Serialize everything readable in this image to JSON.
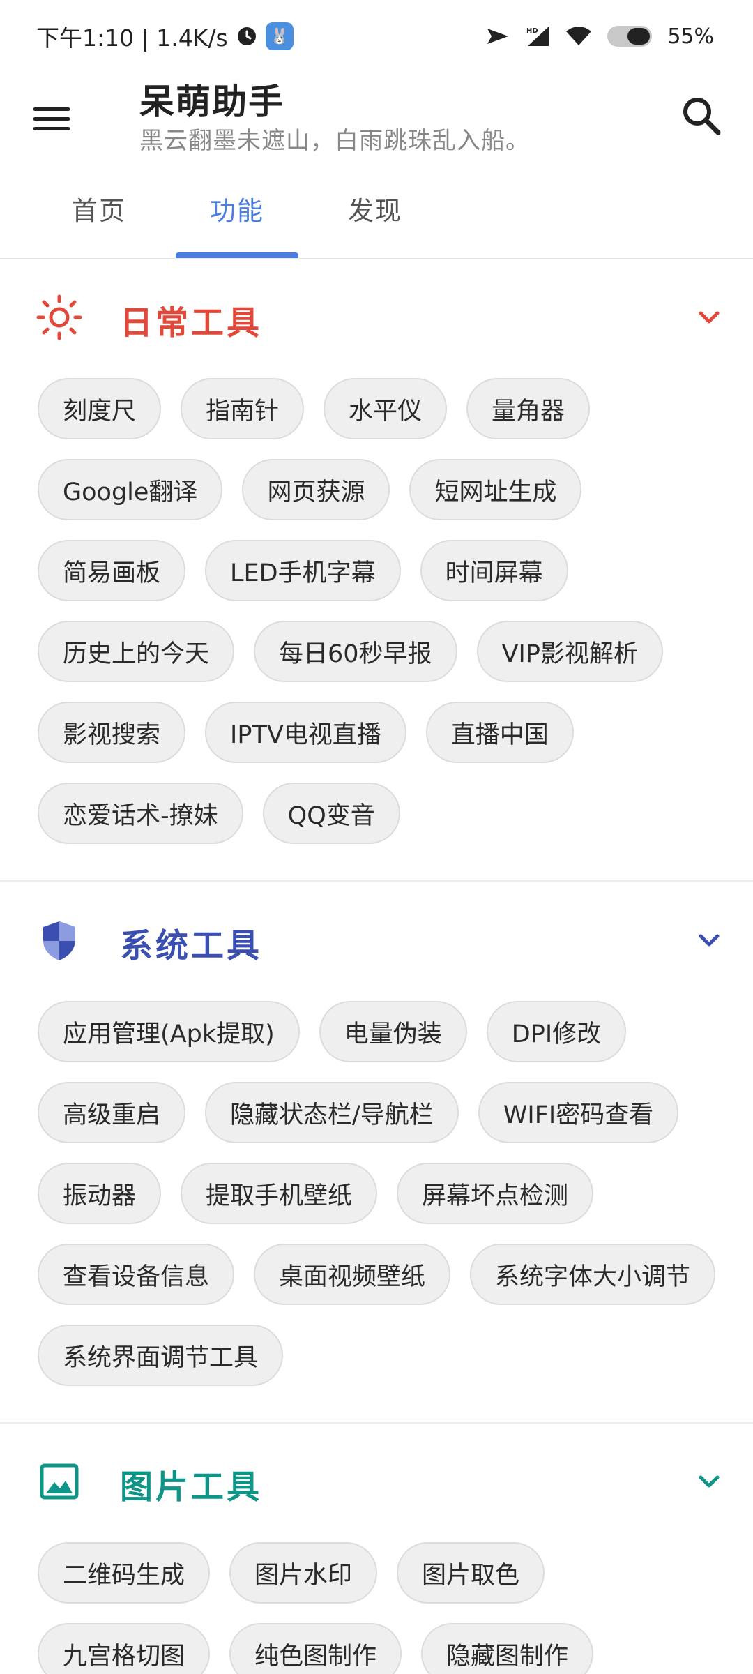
{
  "status_bar": {
    "time_text": "下午1:10 | 1.4K/s",
    "app_badge_icon": "rabbit-icon",
    "battery_text": "55%",
    "battery_level": 0.55
  },
  "app_bar": {
    "title": "呆萌助手",
    "subtitle": "黑云翻墨未遮山，白雨跳珠乱入船。"
  },
  "tabs": [
    {
      "label": "首页"
    },
    {
      "label": "功能"
    },
    {
      "label": "发现"
    }
  ],
  "active_tab": "功能",
  "sections": {
    "daily": {
      "title": "日常工具",
      "color": "#e0493a",
      "icon": "sun-icon",
      "chips": [
        "刻度尺",
        "指南针",
        "水平仪",
        "量角器",
        "Google翻译",
        "网页获源",
        "短网址生成",
        "简易画板",
        "LED手机字幕",
        "时间屏幕",
        "历史上的今天",
        "每日60秒早报",
        "VIP影视解析",
        "影视搜索",
        "IPTV电视直播",
        "直播中国",
        "恋爱话术-撩妹",
        "QQ变音"
      ]
    },
    "system": {
      "title": "系统工具",
      "color": "#3a4fb0",
      "icon": "shield-icon",
      "chips": [
        "应用管理(Apk提取)",
        "电量伪装",
        "DPI修改",
        "高级重启",
        "隐藏状态栏/导航栏",
        "WIFI密码查看",
        "振动器",
        "提取手机壁纸",
        "屏幕坏点检测",
        "查看设备信息",
        "桌面视频壁纸",
        "系统字体大小调节",
        "系统界面调节工具"
      ]
    },
    "image": {
      "title": "图片工具",
      "color": "#0f9488",
      "icon": "image-icon",
      "chips": [
        "二维码生成",
        "图片水印",
        "图片取色",
        "九宫格切图",
        "纯色图制作",
        "隐藏图制作"
      ]
    }
  }
}
